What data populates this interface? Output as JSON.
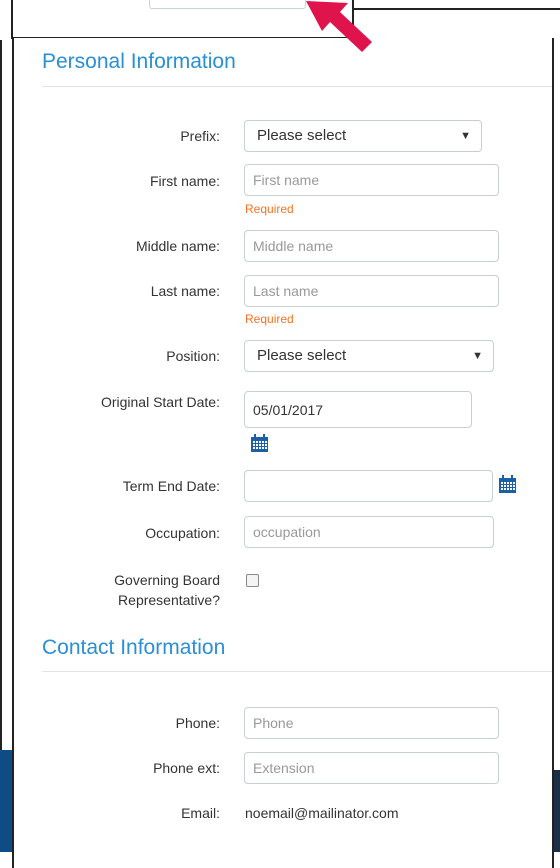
{
  "personal": {
    "title": "Personal Information",
    "prefix": {
      "label": "Prefix:",
      "value": "Please select"
    },
    "first_name": {
      "label": "First name:",
      "placeholder": "First name",
      "hint": "Required"
    },
    "middle_name": {
      "label": "Middle name:",
      "placeholder": "Middle name"
    },
    "last_name": {
      "label": "Last name:",
      "placeholder": "Last name",
      "hint": "Required"
    },
    "position": {
      "label": "Position:",
      "value": "Please select"
    },
    "start_date": {
      "label": "Original Start Date:",
      "value": "05/01/2017"
    },
    "term_end": {
      "label": "Term End Date:",
      "value": ""
    },
    "occupation": {
      "label": "Occupation:",
      "placeholder": "occupation"
    },
    "governing_board": {
      "label_line1": "Governing Board",
      "label_line2": "Representative?"
    }
  },
  "contact": {
    "title": "Contact Information",
    "phone": {
      "label": "Phone:",
      "placeholder": "Phone"
    },
    "phone_ext": {
      "label": "Phone ext:",
      "placeholder": "Extension"
    },
    "email": {
      "label": "Email:",
      "value": "noemail@mailinator.com"
    }
  },
  "colors": {
    "section_title": "#2a8fd4",
    "required": "#f47321",
    "calendar_icon": "#1a5fa8",
    "arrow": "#e0144c"
  },
  "icons": [
    "caret-down-icon",
    "calendar-icon",
    "arrow-pointer-icon"
  ]
}
